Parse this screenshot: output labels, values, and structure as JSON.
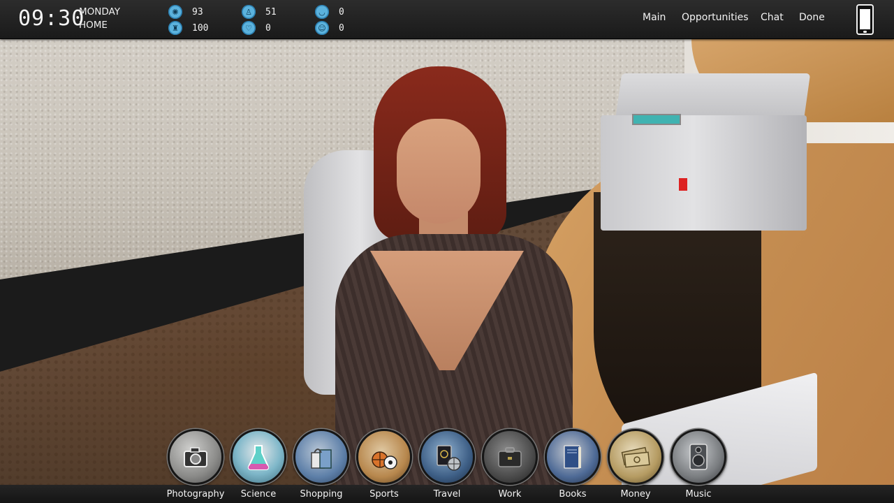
{
  "hud": {
    "time": "09:30",
    "day": "MONDAY",
    "location": "HOME",
    "stats": [
      {
        "icon": "brain-icon",
        "glyph": "✺",
        "value": "93"
      },
      {
        "icon": "fitness-icon",
        "glyph": "♜",
        "value": "100"
      },
      {
        "icon": "charisma-icon",
        "glyph": "♙",
        "value": "51"
      },
      {
        "icon": "heart-icon",
        "glyph": "♡",
        "value": "0"
      },
      {
        "icon": "lips-icon",
        "glyph": "◡",
        "value": "0"
      },
      {
        "icon": "face-icon",
        "glyph": "☺",
        "value": "0"
      }
    ],
    "nav": {
      "main": "Main",
      "opportunities": "Opportunities",
      "chat": "Chat",
      "done": "Done"
    },
    "phone_icon": "smartphone-icon"
  },
  "categories": [
    {
      "label": "Photography",
      "icon": "camera-icon",
      "color": "#8a8a88"
    },
    {
      "label": "Science",
      "icon": "flask-icon",
      "color": "#7fb7c9"
    },
    {
      "label": "Shopping",
      "icon": "shopping-bags-icon",
      "color": "#5d7fa8"
    },
    {
      "label": "Sports",
      "icon": "balls-icon",
      "color": "#b7874d"
    },
    {
      "label": "Travel",
      "icon": "passport-icon",
      "color": "#3e5f86"
    },
    {
      "label": "Work",
      "icon": "briefcase-icon",
      "color": "#4b4b4b"
    },
    {
      "label": "Books",
      "icon": "book-icon",
      "color": "#4e6a96"
    },
    {
      "label": "Money",
      "icon": "money-icon",
      "color": "#b59b62"
    },
    {
      "label": "Music",
      "icon": "speaker-icon",
      "color": "#7a7d80"
    }
  ]
}
